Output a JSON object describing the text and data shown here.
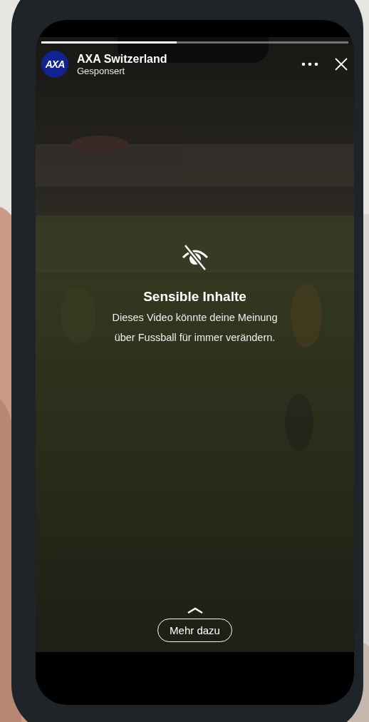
{
  "story": {
    "progress": {
      "level": 0.44
    },
    "account": {
      "logo_text": "AXA",
      "name": "AXA Switzerland",
      "label": "Gesponsert"
    },
    "notice": {
      "title": "Sensible Inhalte",
      "text": "Dieses Video könnte deine Meinung über Fussball für immer verändern."
    },
    "cta": {
      "label": "Mehr dazu"
    }
  }
}
